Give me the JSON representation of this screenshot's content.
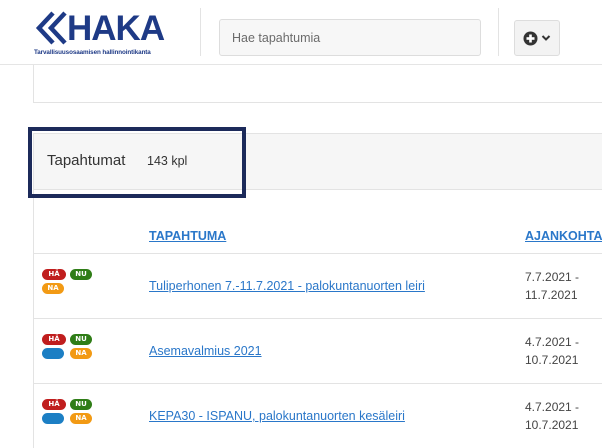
{
  "header": {
    "logo_text": "HAKA",
    "logo_tagline": "Tarvallisuusosaamisen hallinnointikanta",
    "search_placeholder": "Hae tapahtumia",
    "brand_color": "#1e3a86"
  },
  "events": {
    "title": "Tapahtumat",
    "count": "143 kpl",
    "columns": {
      "event": "TAPAHTUMA",
      "time": "AJANKOHTA"
    },
    "rows": [
      {
        "name": "Tuliperhonen 7.-11.7.2021 - palokuntanuorten leiri",
        "start": "7.7.2021 -",
        "end": "11.7.2021",
        "badges": [
          "HÄ",
          "NU",
          "NA"
        ]
      },
      {
        "name": "Asemavalmius 2021",
        "start": "4.7.2021 -",
        "end": "10.7.2021",
        "badges": [
          "HÄ",
          "NU",
          "",
          "NA"
        ]
      },
      {
        "name": "KEPA30 - ISPANU, palokuntanuorten kesäleiri",
        "start": "4.7.2021 -",
        "end": "10.7.2021",
        "badges": [
          "HÄ",
          "NU",
          "",
          "NA"
        ]
      }
    ]
  },
  "badge_colors": {
    "HÄ": "#c01e1e",
    "NU": "#2f7d17",
    "NA": "#f29a14",
    "blank": "#1c7fc4"
  },
  "icons": {
    "add": "plus-circle-icon",
    "dropdown": "chevron-down-icon"
  }
}
